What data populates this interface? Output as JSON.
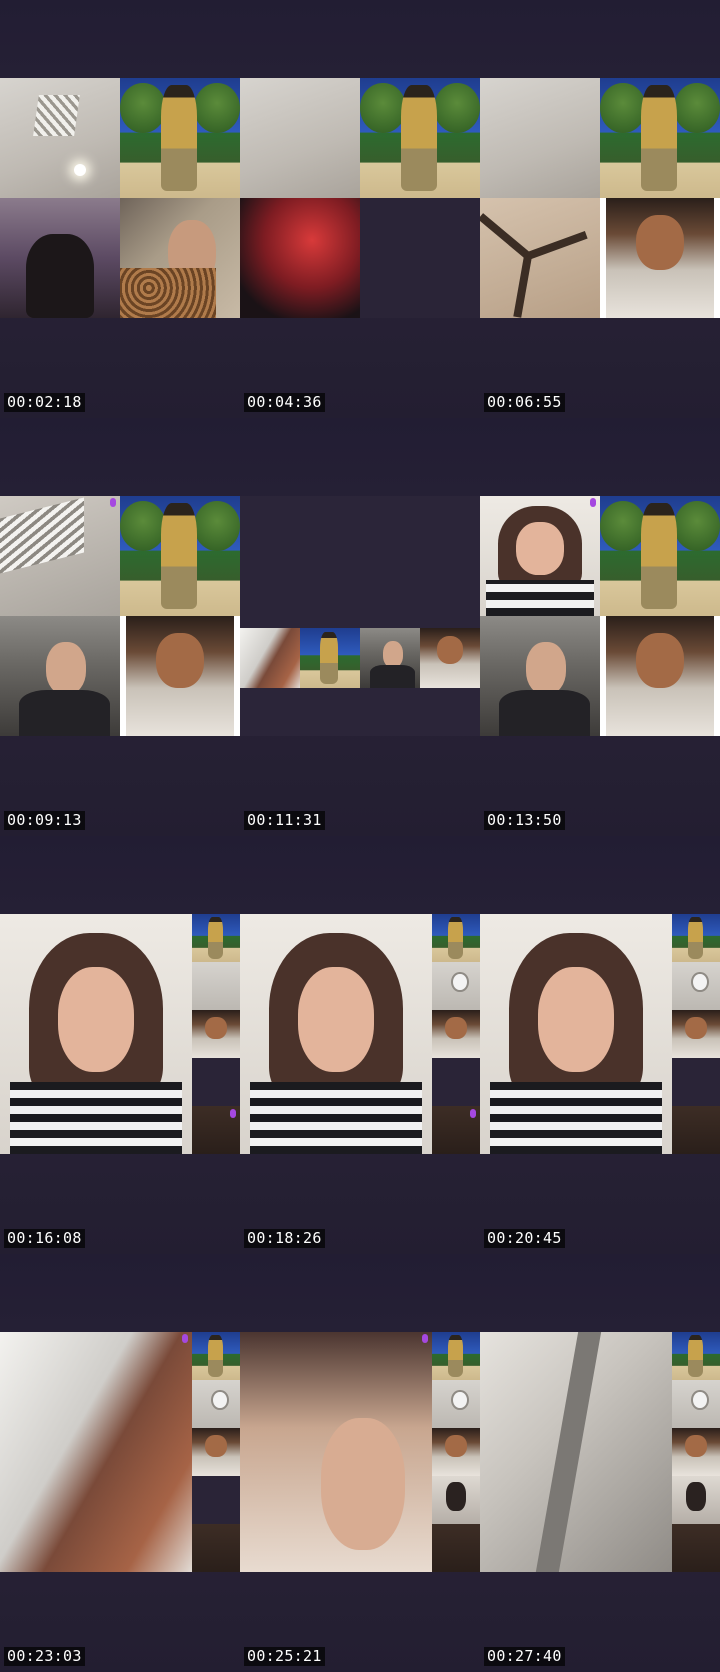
{
  "contact_sheet": {
    "timestamps": [
      "00:02:18",
      "00:04:36",
      "00:06:55",
      "00:09:13",
      "00:11:31",
      "00:13:50",
      "00:16:08",
      "00:18:26",
      "00:20:45",
      "00:23:03",
      "00:25:21",
      "00:27:40"
    ],
    "layout": {
      "rows": 4,
      "columns": 3
    },
    "colors": {
      "cell_background": "#2a2438",
      "timestamp_background": "#0b0a0f",
      "timestamp_text": "#ffffff",
      "mic_indicator": "#a548e0"
    }
  }
}
